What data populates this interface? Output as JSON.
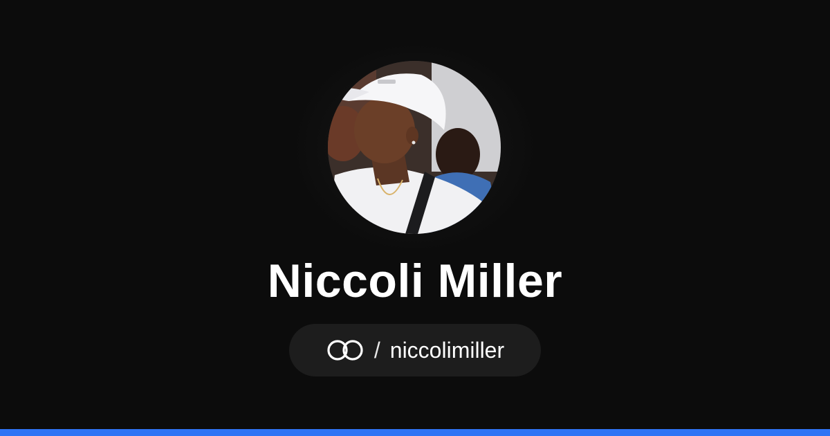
{
  "profile": {
    "display_name": "Niccoli Miller",
    "separator": "/",
    "username": "niccolimiller"
  },
  "icons": {
    "logo": "interlocking-rings-logo-icon",
    "avatar": "profile-photo"
  },
  "colors": {
    "background": "#0c0c0c",
    "pill_background": "#1d1d1d",
    "text": "#ffffff",
    "accent_bar": "#2f74f5"
  }
}
